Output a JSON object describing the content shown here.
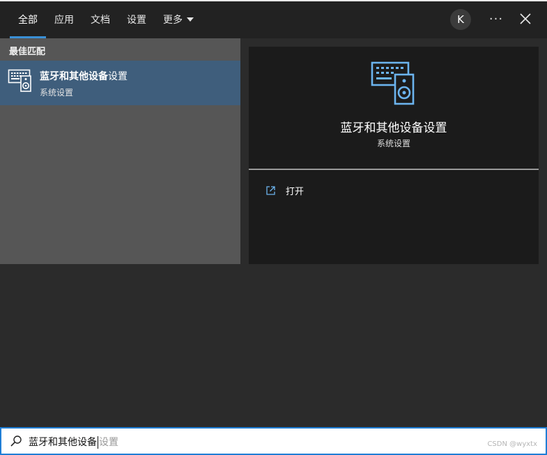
{
  "tabs": [
    {
      "label": "全部",
      "active": true
    },
    {
      "label": "应用"
    },
    {
      "label": "文档"
    },
    {
      "label": "设置"
    },
    {
      "label": "更多"
    }
  ],
  "header": {
    "avatar_letter": "K",
    "more_label": "···"
  },
  "left": {
    "section_title": "最佳匹配",
    "result": {
      "title_bold": "蓝牙和其他设备",
      "title_rest": "设置",
      "subtitle": "系统设置"
    }
  },
  "detail": {
    "title": "蓝牙和其他设备设置",
    "subtitle": "系统设置",
    "open_label": "打开"
  },
  "search": {
    "typed": "蓝牙和其他设备",
    "suggestion": "设置",
    "watermark": "CSDN @wyxtx"
  },
  "colors": {
    "accent": "#3a8fd6",
    "selected_row": "#3f5e7c",
    "icon_blue": "#6cb4ee"
  }
}
